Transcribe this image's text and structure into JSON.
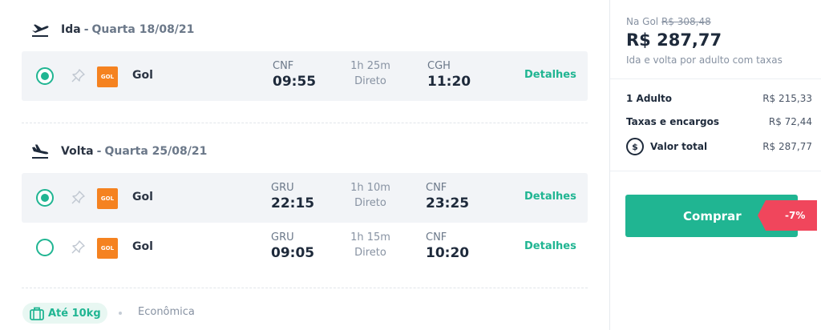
{
  "outbound": {
    "direction": "Ida",
    "date": "Quarta 18/08/21",
    "flights": [
      {
        "selected": true,
        "airline": "Gol",
        "logo_text": "GOL",
        "origin": "CNF",
        "departure": "09:55",
        "duration": "1h 25m",
        "stops": "Direto",
        "destination": "CGH",
        "arrival": "11:20",
        "details_label": "Detalhes"
      }
    ]
  },
  "return": {
    "direction": "Volta",
    "date": "Quarta 25/08/21",
    "flights": [
      {
        "selected": true,
        "airline": "Gol",
        "logo_text": "GOL",
        "origin": "GRU",
        "departure": "22:15",
        "duration": "1h 10m",
        "stops": "Direto",
        "destination": "CNF",
        "arrival": "23:25",
        "details_label": "Detalhes"
      },
      {
        "selected": false,
        "airline": "Gol",
        "logo_text": "GOL",
        "origin": "GRU",
        "departure": "09:05",
        "duration": "1h 15m",
        "stops": "Direto",
        "destination": "CNF",
        "arrival": "10:20",
        "details_label": "Detalhes"
      }
    ]
  },
  "footer": {
    "baggage": "Até 10kg",
    "cabin": "Econômica"
  },
  "summary": {
    "na_gol_label": "Na Gol",
    "old_price": "R$ 308,48",
    "price": "R$ 287,77",
    "price_note": "Ida e volta por adulto com taxas",
    "breakdown": [
      {
        "label": "1 Adulto",
        "value": "R$ 215,33"
      },
      {
        "label": "Taxas e encargos",
        "value": "R$ 72,44"
      }
    ],
    "total_label": "Valor total",
    "total_value": "R$ 287,77",
    "buy_label": "Comprar",
    "discount": "-7%"
  },
  "colors": {
    "accent": "#20b592",
    "discount_badge": "#f0465c",
    "gol_brand": "#f58220"
  },
  "icons": {
    "outbound": "plane-takeoff-icon",
    "return": "plane-landing-icon",
    "pin": "pin-icon",
    "baggage": "suitcase-icon",
    "total": "dollar-coin-icon"
  }
}
